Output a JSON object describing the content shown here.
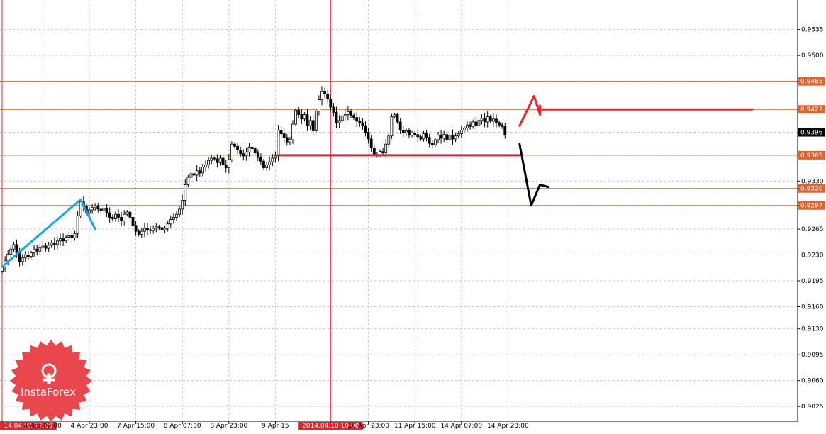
{
  "chart_data": {
    "type": "candlestick",
    "instrument_note": "",
    "y_ticks": [
      "0.9535",
      "0.9500",
      "0.9465",
      "0.9427",
      "0.9396",
      "0.9365",
      "0.9330",
      "0.9320",
      "0.9297",
      "0.9265",
      "0.9230",
      "0.9195",
      "0.9160",
      "0.9130",
      "0.9095",
      "0.9060",
      "0.9025"
    ],
    "ylim": [
      0.9005,
      0.9575
    ],
    "x_ticks": [
      {
        "label": "14.04.03 17:00",
        "slot": 0,
        "highlight": true
      },
      {
        "label": "4 Apr 07:00",
        "slot": 14,
        "highlight": false
      },
      {
        "label": "4 Apr 23:00",
        "slot": 30,
        "highlight": false
      },
      {
        "label": "7 Apr 15:00",
        "slot": 46,
        "highlight": false
      },
      {
        "label": "8 Apr 07:00",
        "slot": 62,
        "highlight": false
      },
      {
        "label": "8 Apr 23:00",
        "slot": 78,
        "highlight": false
      },
      {
        "label": "9 Apr 15",
        "slot": 94,
        "highlight": false
      },
      {
        "label": "2014.04.10 10:00",
        "slot": 113,
        "highlight": true
      },
      {
        "label": "10 Apr 23:00",
        "slot": 126,
        "highlight": false
      },
      {
        "label": "11 Apr 15:00",
        "slot": 142,
        "highlight": false
      },
      {
        "label": "14 Apr 07:00",
        "slot": 158,
        "highlight": false
      },
      {
        "label": "14 Apr 23:00",
        "slot": 174,
        "highlight": false
      }
    ],
    "close_series": [
      0.9214,
      0.9222,
      0.9231,
      0.9238,
      0.9244,
      0.9233,
      0.9221,
      0.9226,
      0.923,
      0.9228,
      0.9233,
      0.9238,
      0.9235,
      0.924,
      0.9242,
      0.9239,
      0.9243,
      0.9246,
      0.9244,
      0.9249,
      0.9252,
      0.9249,
      0.9254,
      0.9256,
      0.9253,
      0.9259,
      0.9283,
      0.9302,
      0.9296,
      0.9287,
      0.9291,
      0.9294,
      0.9296,
      0.9292,
      0.929,
      0.9293,
      0.9287,
      0.9281,
      0.9279,
      0.9285,
      0.9281,
      0.9276,
      0.9285,
      0.9288,
      0.9281,
      0.927,
      0.9262,
      0.9258,
      0.9262,
      0.9266,
      0.9264,
      0.9263,
      0.9266,
      0.9268,
      0.9267,
      0.9264,
      0.9266,
      0.9272,
      0.9278,
      0.9281,
      0.9285,
      0.9292,
      0.9304,
      0.9325,
      0.9335,
      0.934,
      0.9338,
      0.9344,
      0.9341,
      0.9349,
      0.9352,
      0.9358,
      0.9361,
      0.936,
      0.9355,
      0.9361,
      0.9352,
      0.9348,
      0.9359,
      0.938,
      0.9377,
      0.9372,
      0.9367,
      0.9364,
      0.9369,
      0.9376,
      0.9374,
      0.9368,
      0.9362,
      0.9357,
      0.9348,
      0.9352,
      0.9356,
      0.9361,
      0.9364,
      0.9399,
      0.9394,
      0.9389,
      0.9383,
      0.9386,
      0.9407,
      0.9426,
      0.942,
      0.9414,
      0.942,
      0.9405,
      0.9412,
      0.9398,
      0.9425,
      0.944,
      0.9451,
      0.9448,
      0.9441,
      0.943,
      0.9423,
      0.9409,
      0.9412,
      0.9418,
      0.942,
      0.9424,
      0.9419,
      0.9416,
      0.9411,
      0.9409,
      0.9405,
      0.9396,
      0.9387,
      0.9375,
      0.9366,
      0.9365,
      0.937,
      0.9368,
      0.938,
      0.9391,
      0.9417,
      0.942,
      0.941,
      0.9399,
      0.9395,
      0.9398,
      0.9392,
      0.9395,
      0.9393,
      0.939,
      0.9387,
      0.9394,
      0.9389,
      0.9381,
      0.9379,
      0.9386,
      0.9392,
      0.9388,
      0.9393,
      0.9386,
      0.9392,
      0.9387,
      0.9391,
      0.9394,
      0.9399,
      0.9402,
      0.9406,
      0.9404,
      0.941,
      0.9405,
      0.9412,
      0.9415,
      0.941,
      0.9417,
      0.9411,
      0.9414,
      0.9409,
      0.9406,
      0.9404,
      0.9392
    ],
    "price_levels": [
      {
        "price": 0.9465,
        "label": "0.9465",
        "color": "#e0632a"
      },
      {
        "price": 0.9427,
        "label": "0.9427",
        "color": "#e0632a"
      },
      {
        "price": 0.9365,
        "label": "0.9365",
        "color": "#e0632a"
      },
      {
        "price": 0.932,
        "label": "0.9320",
        "color": "#e0632a"
      },
      {
        "price": 0.9297,
        "label": "0.9297",
        "color": "#e0632a"
      }
    ],
    "current_price": {
      "price": 0.9396,
      "label": "0.9396"
    },
    "vertical_markers": [
      {
        "slot": 0
      },
      {
        "slot": 113
      }
    ],
    "drawn_segments": [
      {
        "color": "#e8242b",
        "width": 3,
        "points": [
          [
            95,
            0.9365
          ],
          [
            178,
            0.9365
          ]
        ]
      },
      {
        "color": "#e8242b",
        "width": 3,
        "points": [
          [
            185,
            0.9427
          ],
          [
            258,
            0.9427
          ]
        ]
      },
      {
        "color": "#e8242b",
        "width": 3,
        "points": [
          [
            178,
            0.9405
          ],
          [
            183,
            0.9445
          ],
          [
            185,
            0.942
          ],
          [
            185,
            0.9432
          ]
        ]
      },
      {
        "color": "#000000",
        "width": 3,
        "points": [
          [
            178,
            0.938
          ],
          [
            182,
            0.9297
          ],
          [
            185,
            0.9325
          ],
          [
            188,
            0.9322
          ]
        ]
      },
      {
        "color": "#1aa7e8",
        "width": 3,
        "points": [
          [
            0,
            0.9214
          ],
          [
            27,
            0.9305
          ],
          [
            32,
            0.9265
          ]
        ]
      }
    ],
    "grid": true,
    "candle_colors": {
      "up": "#ffffff",
      "down": "#000000",
      "outline": "#000000"
    }
  },
  "logo": {
    "text": "InstaForex",
    "color": "#e9474d"
  },
  "colors": {
    "background": "#ffffff",
    "grid": "#c8c8c8",
    "level": "#e0632a",
    "marker": "#e8242b",
    "axis_tag_dark": "#000000"
  }
}
